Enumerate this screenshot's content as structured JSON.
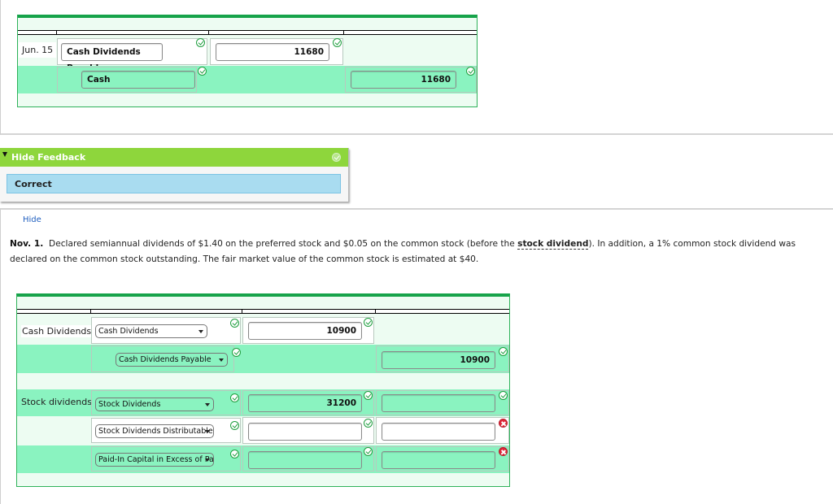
{
  "top_entry": {
    "date": "Jun. 15",
    "rows": [
      {
        "account": "Cash Dividends Payable",
        "debit": "11680",
        "credit": "",
        "account_status": "correct",
        "debit_status": "correct"
      },
      {
        "account": "Cash",
        "debit": "",
        "credit": "11680",
        "account_status": "correct",
        "credit_status": "correct"
      }
    ]
  },
  "feedback": {
    "toggle_label": "Hide Feedback",
    "result": "Correct"
  },
  "hide_link": "Hide",
  "question": {
    "date_label": "Nov. 1.",
    "text_before_term": "Declared semiannual dividends of $1.40 on the preferred stock and $0.05 on the common stock (before the ",
    "term": "stock dividend",
    "text_after_term": "). In addition, a 1% common stock dividend was declared on the common stock outstanding. The fair market value of the common stock is estimated at $40."
  },
  "bottom_entry": {
    "rows": [
      {
        "label": "Cash Dividends",
        "account": "Cash Dividends",
        "debit": "10900",
        "credit": null,
        "account_status": "correct",
        "debit_status": "correct"
      },
      {
        "label": "",
        "account": "Cash Dividends Payable",
        "debit": null,
        "credit": "10900",
        "account_status": "correct",
        "credit_status": "correct"
      },
      {
        "label": "Stock dividends",
        "account": "Stock Dividends",
        "debit": "31200",
        "credit": "",
        "account_status": "correct",
        "debit_status": "correct",
        "credit_status": "correct"
      },
      {
        "label": "",
        "account": "Stock Dividends Distributable",
        "debit": "",
        "credit": "",
        "account_status": "correct",
        "debit_status": "correct",
        "credit_status": "incorrect"
      },
      {
        "label": "",
        "account": "Paid-In Capital in Excess of Par",
        "debit": "",
        "credit": "",
        "account_status": "correct",
        "debit_status": "correct",
        "credit_status": "incorrect"
      }
    ]
  },
  "colors": {
    "header_green": "#16a34a",
    "row_mint": "#8af3c0",
    "row_pale": "#edfcf2",
    "feedback_green": "#8ed63c",
    "feedback_blue": "#a9dcf0",
    "correct": "#1e9e3e",
    "incorrect": "#e0283a",
    "link": "#1f5fbf"
  }
}
